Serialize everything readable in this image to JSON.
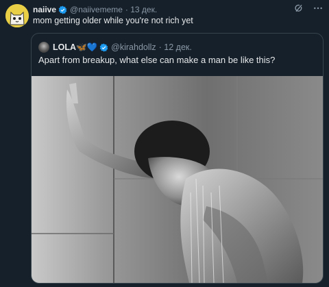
{
  "tweet": {
    "author_name": "naiive",
    "handle": "@naiivememe",
    "date": "· 13 дек.",
    "text": "mom getting older while you're not rich yet"
  },
  "quoted": {
    "author_name": "LOLA🦋💙",
    "handle": "@kirahdollz",
    "date": "· 12 дек.",
    "text": "Apart from breakup, what else can make a man be like this?"
  },
  "icons": [
    "grok-icon",
    "more-icon",
    "verified-icon"
  ],
  "colors": {
    "background": "#15202b",
    "verified": "#1d9bf0",
    "muted_text": "#8b98a5",
    "border": "#38444d"
  }
}
